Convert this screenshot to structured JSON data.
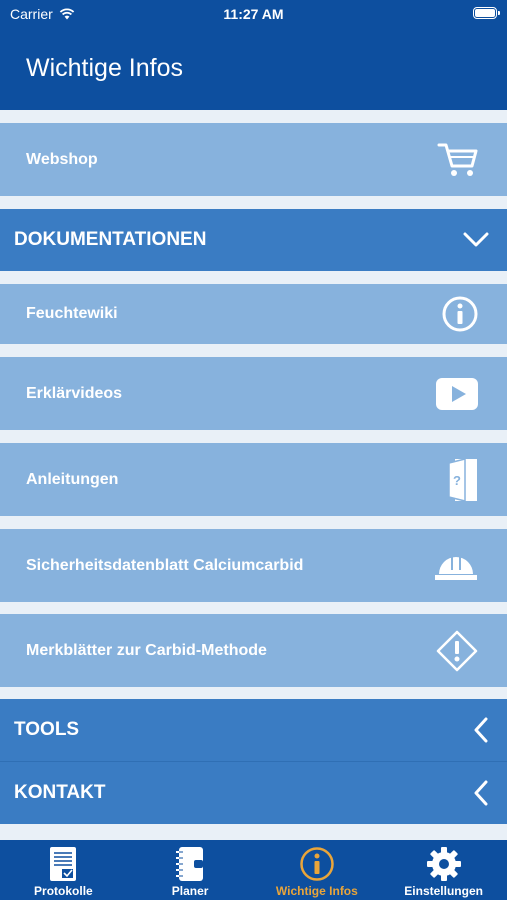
{
  "status_bar": {
    "carrier": "Carrier",
    "time": "11:27 AM"
  },
  "header": {
    "title": "Wichtige Infos"
  },
  "webshop": {
    "label": "Webshop",
    "icon": "cart-icon"
  },
  "dokumentationen": {
    "title": "DOKUMENTATIONEN",
    "expanded": true,
    "items": [
      {
        "label": "Feuchtewiki",
        "icon": "info-circle-icon"
      },
      {
        "label": "Erklärvideos",
        "icon": "video-play-icon"
      },
      {
        "label": "Anleitungen",
        "icon": "manual-door-icon"
      },
      {
        "label": "Sicherheitsdatenblatt Calciumcarbid",
        "icon": "hard-hat-icon"
      },
      {
        "label": "Merkblätter zur Carbid-Methode",
        "icon": "warning-diamond-icon"
      }
    ]
  },
  "tools": {
    "title": "TOOLS",
    "expanded": false
  },
  "kontakt": {
    "title": "KONTAKT",
    "expanded": false
  },
  "tabs": [
    {
      "label": "Protokolle",
      "icon": "document-list-icon",
      "active": false
    },
    {
      "label": "Planer",
      "icon": "planner-notebook-icon",
      "active": false
    },
    {
      "label": "Wichtige Infos",
      "icon": "info-circle-icon",
      "active": true
    },
    {
      "label": "Einstellungen",
      "icon": "gear-icon",
      "active": false
    }
  ],
  "colors": {
    "primary": "#0d4f9f",
    "section": "#3a7cc3",
    "item": "#87b2dd",
    "background": "#e9f0f7",
    "active_tab": "#e9a53a"
  }
}
